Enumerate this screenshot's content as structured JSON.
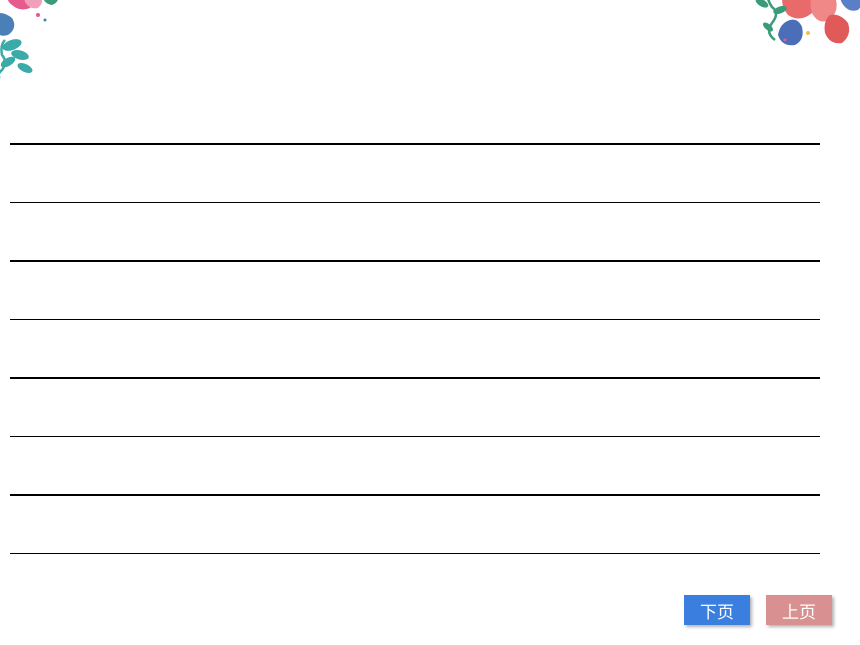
{
  "nav": {
    "next_label": "下页",
    "prev_label": "上页"
  },
  "colors": {
    "next_button_bg": "#3a7fe0",
    "prev_button_bg": "#d99090",
    "line_color": "#000000"
  },
  "lines_count": 8
}
